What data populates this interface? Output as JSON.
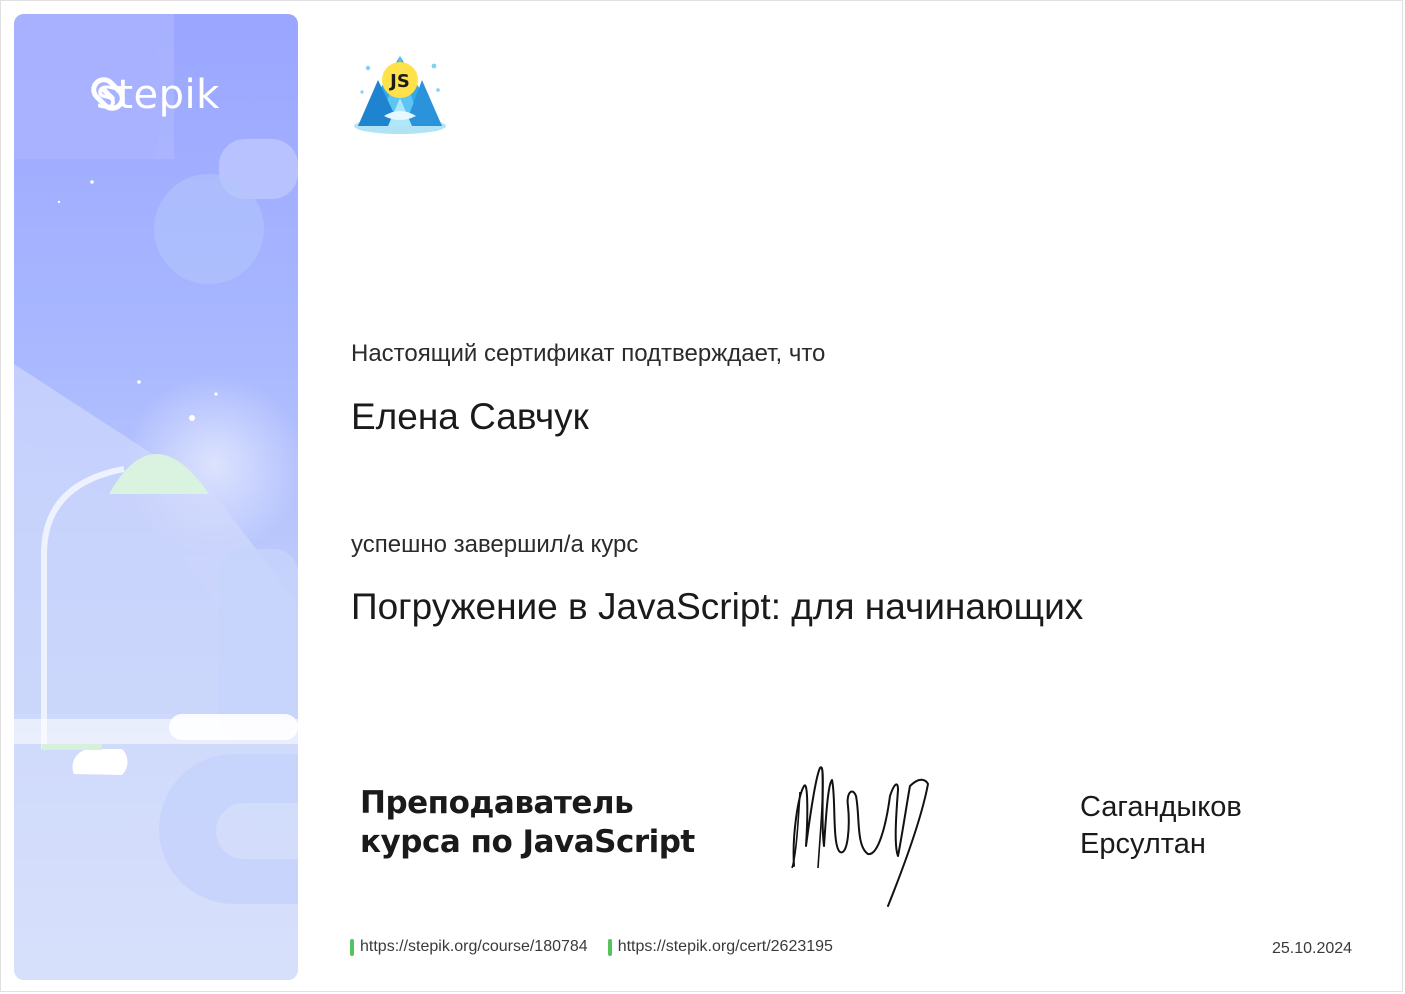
{
  "brand": {
    "name": "stepik",
    "icon": "stepik-logo-icon"
  },
  "course_logo": {
    "label": "JS",
    "icon": "js-iceberg-logo-icon"
  },
  "certificate": {
    "intro": "Настоящий сертификат подтверждает, что",
    "recipient": "Елена Савчук",
    "completed_text": "успешно завершил/а  курс",
    "course_title": "Погружение в JavaScript: для начинающих"
  },
  "teacher": {
    "role_line1": "Преподаватель",
    "role_line2": "курса по JavaScript",
    "name_line1": "Сагандыков",
    "name_line2": "Ерсултан"
  },
  "footer": {
    "course_url": "https://stepik.org/course/180784",
    "cert_url": "https://stepik.org/cert/2623195",
    "date": "25.10.2024"
  },
  "colors": {
    "accent_link_bar": "#55c35d",
    "panel_top": "#9aa6ff",
    "panel_bottom": "#dde6fb"
  }
}
